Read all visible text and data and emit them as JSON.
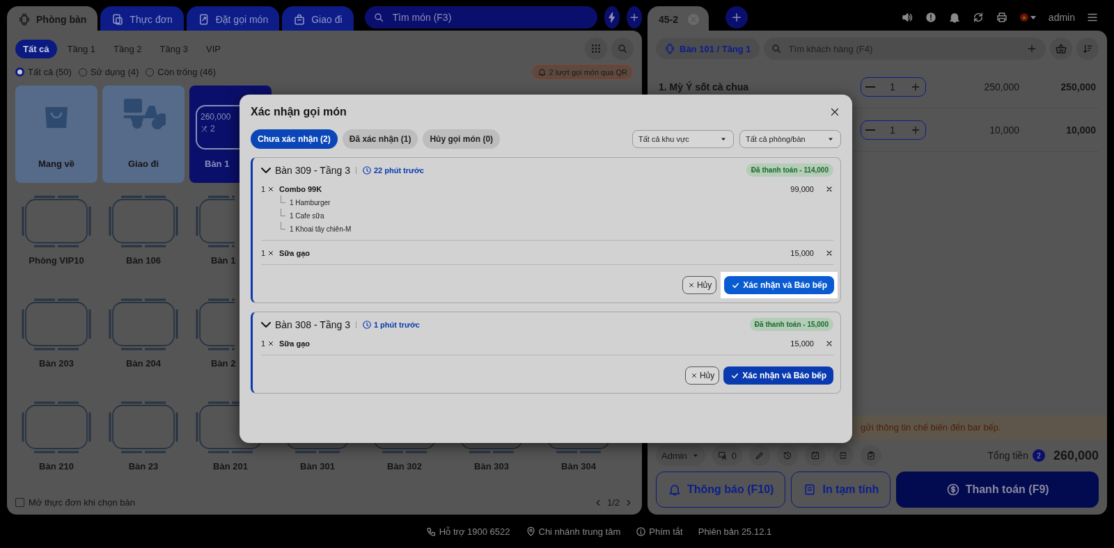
{
  "left_tabs": [
    {
      "label": "Phòng bàn",
      "kind": "tables",
      "selected": true
    },
    {
      "label": "Thực đơn",
      "kind": "menu",
      "selected": false
    },
    {
      "label": "Đặt gọi món",
      "kind": "order",
      "selected": false
    },
    {
      "label": "Giao đi",
      "kind": "bag",
      "selected": false
    }
  ],
  "menu_search": {
    "placeholder": "Tìm món (F3)"
  },
  "floor_filters": [
    {
      "label": "Tất cả",
      "selected": true
    },
    {
      "label": "Tầng 1",
      "selected": false
    },
    {
      "label": "Tầng 2",
      "selected": false
    },
    {
      "label": "Tầng 3",
      "selected": false
    },
    {
      "label": "VIP",
      "selected": false
    }
  ],
  "status_filters": [
    {
      "label": "Tất cả (50)",
      "selected": true
    },
    {
      "label": "Sử dụng (4)",
      "selected": false
    },
    {
      "label": "Còn trống (46)",
      "selected": false
    }
  ],
  "qr_badge": "2 lượt gọi món qua QR",
  "table_rows": [
    [
      {
        "kind": "takeaway",
        "label": "Mang về"
      },
      {
        "kind": "delivery",
        "label": "Giao đi"
      },
      {
        "kind": "occupied",
        "label": "Bàn 1",
        "amount": "260,000",
        "guests": "2",
        "cut": true
      }
    ],
    [
      {
        "kind": "table",
        "label": "Phòng VIP10"
      },
      {
        "kind": "table",
        "label": "Bàn 106"
      },
      {
        "kind": "table",
        "label": "Bàn 1",
        "cut": true
      }
    ],
    [
      {
        "kind": "table",
        "label": "Bàn 203"
      },
      {
        "kind": "table",
        "label": "Bàn 204"
      },
      {
        "kind": "table",
        "label": "Bàn 2",
        "cut": true
      }
    ],
    [
      {
        "kind": "table",
        "label": "Bàn 210"
      },
      {
        "kind": "table",
        "label": "Bàn 23"
      },
      {
        "kind": "table",
        "label": "Bàn 201"
      },
      {
        "kind": "table",
        "label": "Bàn 301"
      },
      {
        "kind": "table",
        "label": "Bàn 302"
      },
      {
        "kind": "table",
        "label": "Bàn 303"
      },
      {
        "kind": "table",
        "label": "Bàn 304"
      }
    ]
  ],
  "open_menu_option": {
    "label": "Mở thực đơn khi chọn bàn",
    "checked": false
  },
  "pager": "1/2",
  "order_tabs": [
    {
      "label": "45-2",
      "selected": true
    }
  ],
  "user": "admin",
  "location": "Bàn 101 / Tầng 1",
  "customer_search": {
    "placeholder": "Tìm khách hàng (F4)"
  },
  "order_items": [
    {
      "name": "1. Mỳ Ý sốt cà chua",
      "quantity": "1",
      "price": "250,000",
      "total": "250,000"
    },
    {
      "quantity": "1",
      "price": "10,000",
      "total": "10,000"
    }
  ],
  "warning": "gửi thông tin chế biến đến bar bếp.",
  "staff": "Admin",
  "guest_count": "0",
  "total_label": "Tổng tiền",
  "item_count": "2",
  "total": "260,000",
  "actions": [
    {
      "label": "Thông báo (F10)",
      "kind": "notify"
    },
    {
      "label": "In tạm tính",
      "kind": "print"
    },
    {
      "label": "Thanh toán (F9)",
      "kind": "pay"
    }
  ],
  "footer": [
    {
      "kind": "phone",
      "label": "Hỗ trợ 1900 6522"
    },
    {
      "kind": "pin",
      "label": "Chi nhánh trung tâm"
    },
    {
      "kind": "info",
      "label": "Phím tắt"
    },
    {
      "kind": "none",
      "label": "Phiên bản 25.12.1"
    }
  ],
  "modal": {
    "title": "Xác nhận gọi món",
    "tabs": [
      {
        "label": "Chưa xác nhận (2)",
        "selected": true
      },
      {
        "label": "Đã xác nhận (1)",
        "selected": false
      },
      {
        "label": "Hủy gọi món (0)",
        "selected": false
      }
    ],
    "filters": [
      "Tất cả khu vực",
      "Tất cả phòng/bàn"
    ],
    "orders": [
      {
        "title": "Bàn 309 - Tầng 3",
        "time": "22 phút trước",
        "status": "Đã thanh toán - 114,000",
        "expanded": true,
        "highlighted": true,
        "cancel": "Hủy",
        "confirm": "Xác nhận và Báo bếp",
        "items": [
          {
            "quantity": "1",
            "name": "Combo 99K",
            "price": "99,000",
            "components": [
              "1 Hamburger",
              "1 Cafe sữa",
              "1 Khoai tây chiên-M"
            ]
          },
          {
            "quantity": "1",
            "name": "Sữa gạo",
            "price": "15,000"
          }
        ]
      },
      {
        "title": "Bàn 308 - Tầng 3",
        "time": "1 phút trước",
        "status": "Đã thanh toán - 15,000",
        "expanded": true,
        "highlighted": false,
        "cancel": "Hủy",
        "confirm": "Xác nhận và Báo bếp",
        "items": [
          {
            "quantity": "1",
            "name": "Sữa gạo",
            "price": "15,000"
          }
        ]
      }
    ]
  }
}
